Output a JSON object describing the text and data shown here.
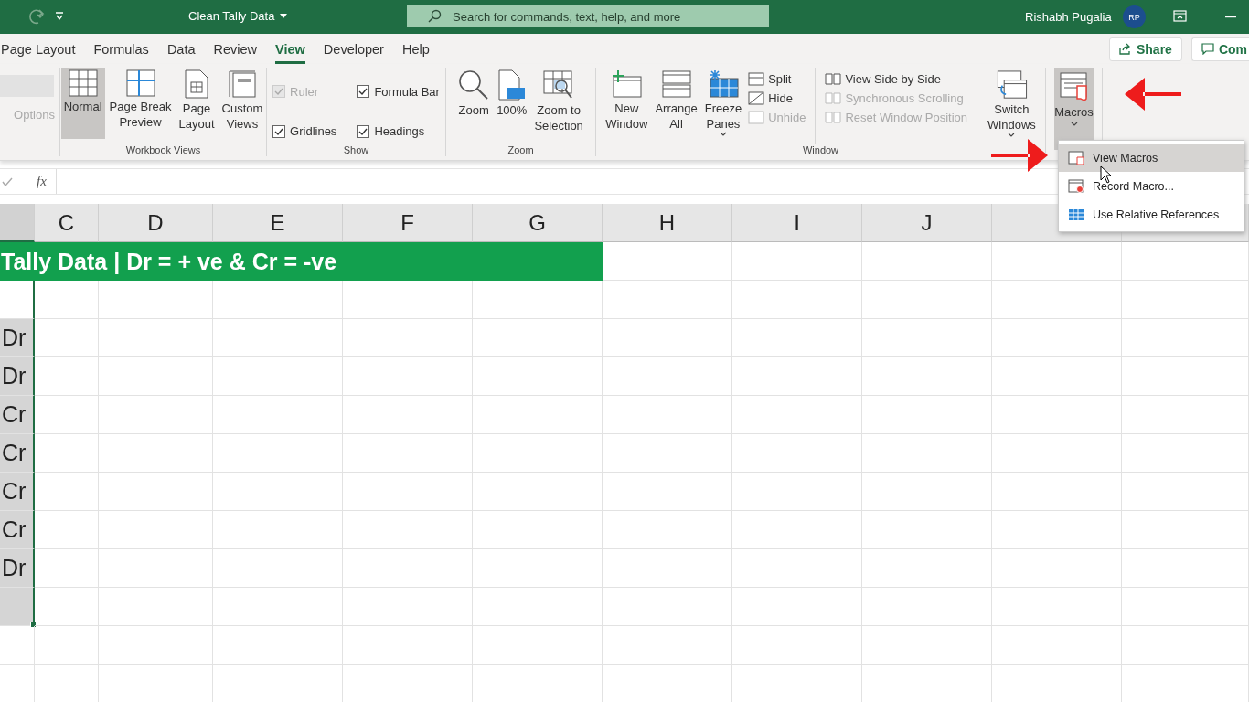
{
  "title_bar": {
    "document_title": "Clean Tally Data",
    "search_placeholder": "Search for commands, text, help, and more",
    "user_name": "Rishabh Pugalia",
    "user_initials": "RP"
  },
  "tabs": [
    {
      "label": "Page Layout",
      "selected": false
    },
    {
      "label": "Formulas",
      "selected": false
    },
    {
      "label": "Data",
      "selected": false
    },
    {
      "label": "Review",
      "selected": false
    },
    {
      "label": "View",
      "selected": true
    },
    {
      "label": "Developer",
      "selected": false
    },
    {
      "label": "Help",
      "selected": false
    }
  ],
  "share_button": "Share",
  "comments_button": "Com",
  "ribbon": {
    "sheet_view": {
      "options_label": "Options"
    },
    "workbook_views": {
      "label": "Workbook Views",
      "buttons": [
        {
          "label": "Normal",
          "selected": true
        },
        {
          "label": "Page Break\nPreview",
          "selected": false
        },
        {
          "label": "Page\nLayout",
          "selected": false
        },
        {
          "label": "Custom\nViews",
          "selected": false
        }
      ]
    },
    "show": {
      "label": "Show",
      "checkboxes": [
        {
          "label": "Ruler",
          "checked": true,
          "disabled": true
        },
        {
          "label": "Formula Bar",
          "checked": true,
          "disabled": false
        },
        {
          "label": "Gridlines",
          "checked": true,
          "disabled": false
        },
        {
          "label": "Headings",
          "checked": true,
          "disabled": false
        }
      ]
    },
    "zoom": {
      "label": "Zoom",
      "buttons": [
        {
          "label": "Zoom"
        },
        {
          "label": "100%"
        },
        {
          "label": "Zoom to\nSelection"
        }
      ]
    },
    "window": {
      "label": "Window",
      "large_buttons": [
        {
          "label": "New\nWindow",
          "dropdown": false
        },
        {
          "label": "Arrange\nAll",
          "dropdown": false
        },
        {
          "label": "Freeze\nPanes",
          "dropdown": true
        }
      ],
      "small_buttons": [
        {
          "label": "Split",
          "disabled": false
        },
        {
          "label": "Hide",
          "disabled": false
        },
        {
          "label": "Unhide",
          "disabled": true
        }
      ],
      "side_buttons": [
        {
          "label": "View Side by Side",
          "disabled": false
        },
        {
          "label": "Synchronous Scrolling",
          "disabled": true
        },
        {
          "label": "Reset Window Position",
          "disabled": true
        }
      ],
      "switch_button": {
        "label": "Switch\nWindows",
        "dropdown": true
      }
    },
    "macros": {
      "label": "Macros",
      "selected": true
    }
  },
  "macros_menu": [
    {
      "label": "View Macros",
      "selected": true
    },
    {
      "label": "Record Macro...",
      "selected": false
    },
    {
      "label": "Use Relative References",
      "selected": false
    }
  ],
  "formula_bar": {
    "fx_label": "fx"
  },
  "sheet": {
    "columns": [
      "C",
      "D",
      "E",
      "F",
      "G",
      "H",
      "I",
      "J"
    ],
    "title": "Tally Data | Dr = + ve & Cr = -ve",
    "column_b_values": [
      "Dr",
      "Dr",
      "Cr",
      "Cr",
      "Cr",
      "Cr",
      "Dr"
    ]
  }
}
